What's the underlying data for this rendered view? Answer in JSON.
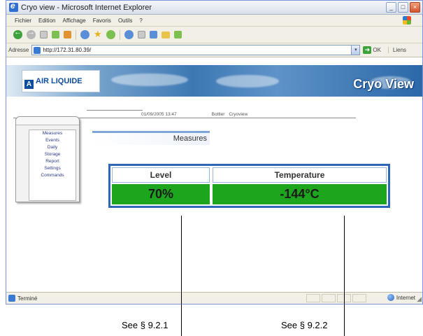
{
  "window": {
    "title": "Cryo view - Microsoft Internet Explorer",
    "menu": [
      "Fichier",
      "Edition",
      "Affichage",
      "Favoris",
      "Outils",
      "?"
    ],
    "address_label": "Adresse",
    "address_value": "http://172.31.80.39/",
    "go_label": "OK",
    "links_label": "Liens",
    "status_text": "Terminé",
    "zone_label": "Internet"
  },
  "header": {
    "logo_text": "AIR LIQUIDE",
    "logo_mark": "A",
    "brand": "Cryo View"
  },
  "info": {
    "datetime": "01/09/2005 13:47",
    "user": "Bottler",
    "site": "Cryoview"
  },
  "sidebar": {
    "items": [
      "Measures",
      "Events",
      "Daily",
      "Storage",
      "Report",
      "Settings",
      "Commands"
    ]
  },
  "section_title": "Measures",
  "measures": {
    "headers": [
      "Level",
      "Temperature"
    ],
    "values": [
      "70%",
      "-144°C"
    ],
    "value_color": "#1ea51e"
  },
  "callouts": [
    "See § 9.2.1",
    "See § 9.2.2"
  ]
}
